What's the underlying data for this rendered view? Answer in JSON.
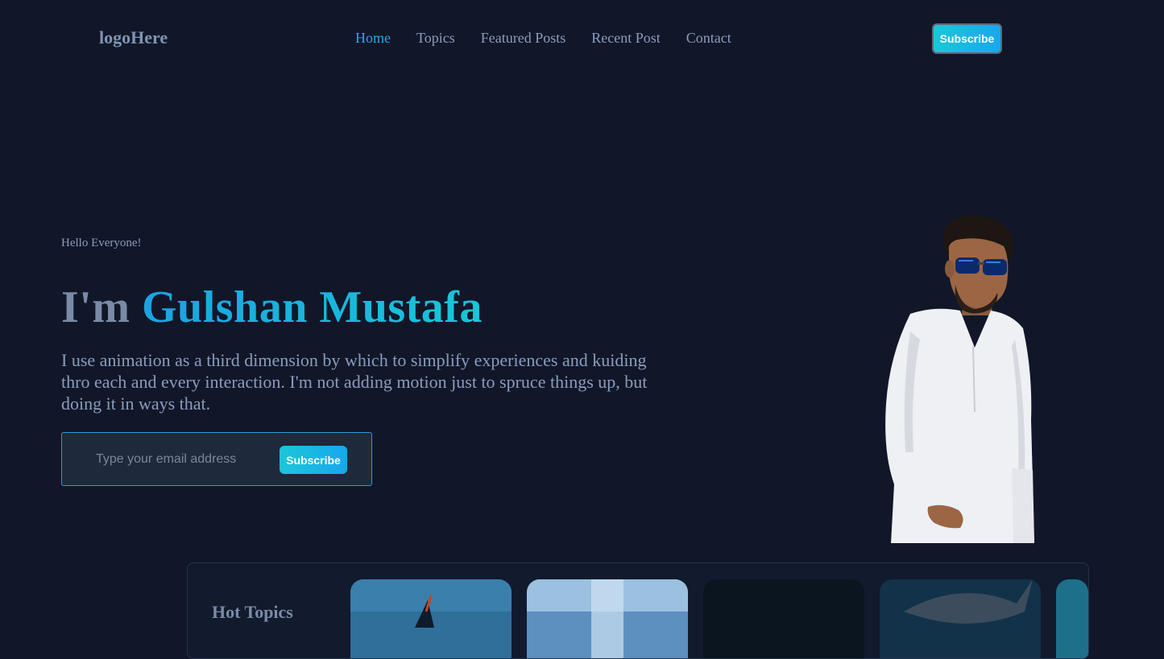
{
  "header": {
    "logo": "logoHere",
    "nav": [
      {
        "label": "Home",
        "active": true
      },
      {
        "label": "Topics",
        "active": false
      },
      {
        "label": "Featured Posts",
        "active": false
      },
      {
        "label": "Recent Post",
        "active": false
      },
      {
        "label": "Contact",
        "active": false
      }
    ],
    "subscribe_label": "Subscribe"
  },
  "hero": {
    "greeting": "Hello Everyone!",
    "headline_prefix": "I'm ",
    "headline_name": "Gulshan Mustafa",
    "intro": "I use animation as a third dimension by which to simplify experiences and kuiding thro each and every interaction. I'm not adding motion just to spruce things up, but doing it in ways that.",
    "email_placeholder": "Type your email address",
    "subscribe_label": "Subscribe"
  },
  "topics": {
    "title": "Hot Topics",
    "cards": [
      {
        "image": "windsurfing-photo"
      },
      {
        "image": "waterfall-photo"
      },
      {
        "image": "dark-photo"
      },
      {
        "image": "whale-photo"
      },
      {
        "image": "partial-photo"
      }
    ]
  },
  "colors": {
    "background": "#111729",
    "accent": "#18a7ee",
    "accent_alt": "#1bc7d8",
    "text_muted": "#8b9cbc"
  }
}
